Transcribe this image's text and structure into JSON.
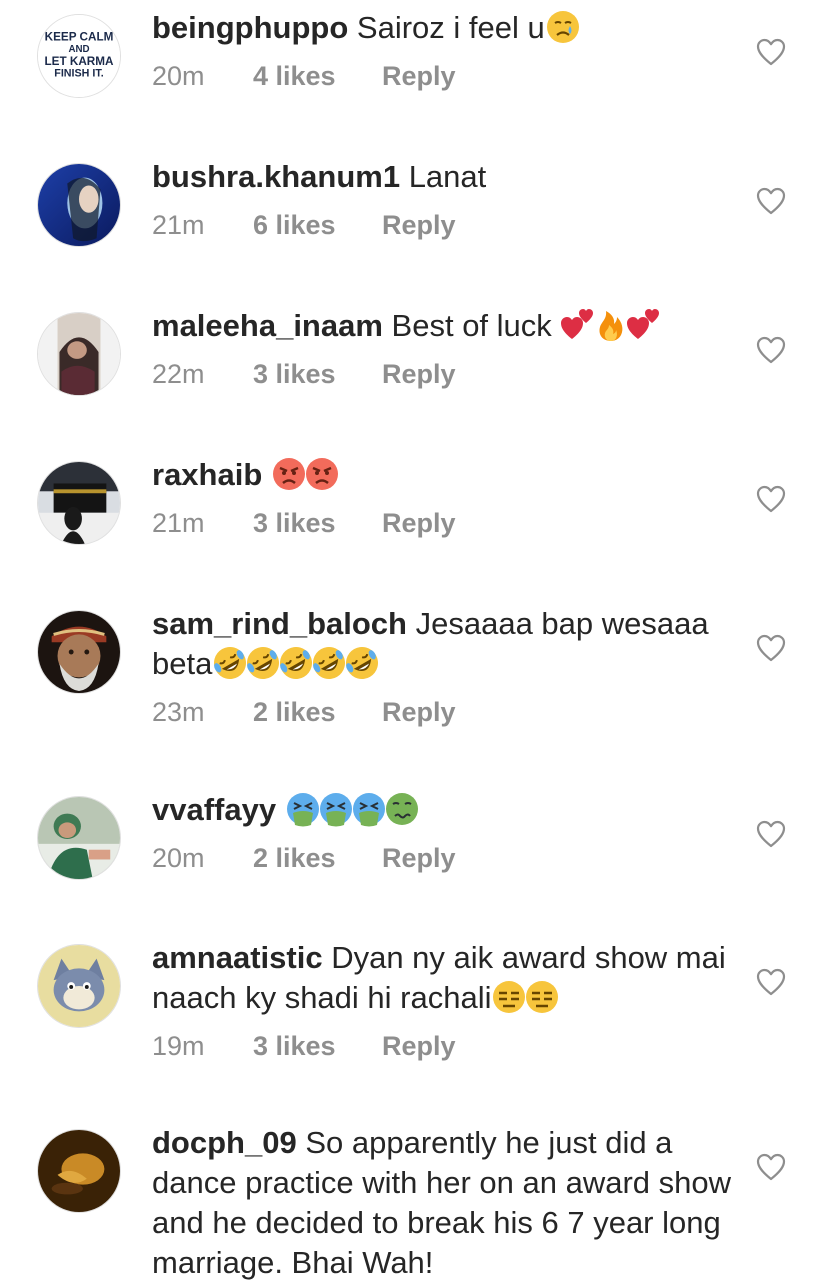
{
  "comments": [
    {
      "username": "beingphuppo",
      "text": "Sairoz i feel u",
      "emojis": [
        "crying-face"
      ],
      "time": "20m",
      "likes": "4 likes",
      "reply": "Reply",
      "avatar_icon": "keep-calm-avatar",
      "avatar_text": [
        "KEEP CALM",
        "AND",
        "LET KARMA",
        "FINISH IT."
      ]
    },
    {
      "username": "bushra.khanum1",
      "text": "Lanat",
      "emojis": [],
      "time": "21m",
      "likes": "6 likes",
      "reply": "Reply",
      "avatar_icon": "user-photo-avatar"
    },
    {
      "username": "maleeha_inaam",
      "text": "Best of luck",
      "emojis": [
        "two-hearts",
        "fire",
        "two-hearts"
      ],
      "time": "22m",
      "likes": "3 likes",
      "reply": "Reply",
      "avatar_icon": "user-photo-avatar"
    },
    {
      "username": "raxhaib",
      "text": "",
      "emojis": [
        "angry-face",
        "angry-face"
      ],
      "time": "21m",
      "likes": "3 likes",
      "reply": "Reply",
      "avatar_icon": "kaaba-photo-avatar"
    },
    {
      "username": "sam_rind_baloch",
      "text": "Jesaaaa bap wesaaa beta",
      "emojis": [
        "rolling-laughing-face",
        "rolling-laughing-face",
        "rolling-laughing-face",
        "rolling-laughing-face",
        "rolling-laughing-face"
      ],
      "time": "23m",
      "likes": "2 likes",
      "reply": "Reply",
      "avatar_icon": "old-man-photo-avatar"
    },
    {
      "username": "vvaffayy",
      "text": "",
      "emojis": [
        "vomiting-face",
        "vomiting-face",
        "vomiting-face",
        "nauseated-face"
      ],
      "time": "20m",
      "likes": "2 likes",
      "reply": "Reply",
      "avatar_icon": "surgeon-photo-avatar"
    },
    {
      "username": "amnaatistic",
      "text": "Dyan ny aik award show mai naach ky shadi hi rachali",
      "emojis": [
        "expressionless-face",
        "expressionless-face"
      ],
      "time": "19m",
      "likes": "3 likes",
      "reply": "Reply",
      "avatar_icon": "cartoon-cat-avatar"
    },
    {
      "username": "docph_09",
      "text": "So apparently he just did a dance practice with her on an award show and he decided to break his 6 7 year long marriage. Bhai Wah!",
      "emojis": [],
      "time": "",
      "likes": "",
      "reply": "",
      "avatar_icon": "dark-photo-avatar"
    }
  ],
  "colors": {
    "text": "#262626",
    "meta": "#8e8e8e",
    "heart_outline": "#8e8e8e"
  },
  "icons": {
    "like": "heart-outline-icon"
  }
}
